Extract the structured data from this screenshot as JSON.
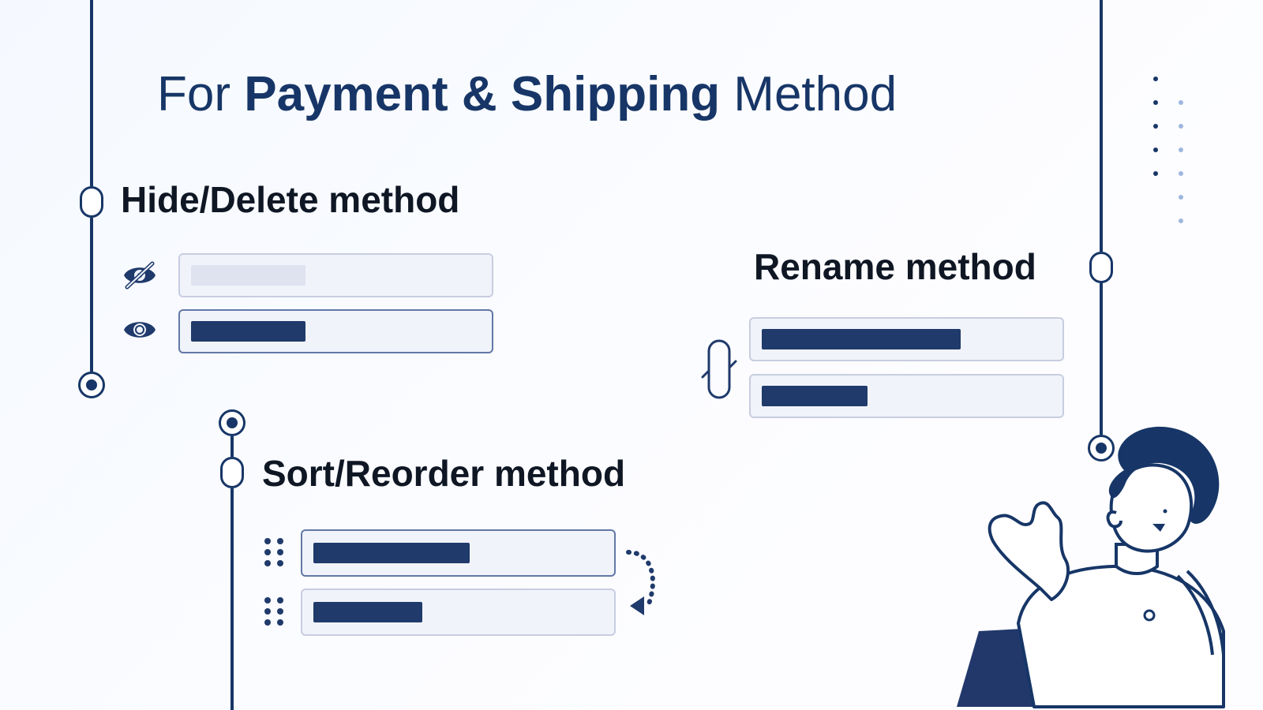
{
  "heading": {
    "pre": "For ",
    "bold": "Payment & Shipping",
    "post": " Method"
  },
  "sections": {
    "hide": "Hide/Delete method",
    "rename": "Rename method",
    "sort": "Sort/Reorder method"
  }
}
